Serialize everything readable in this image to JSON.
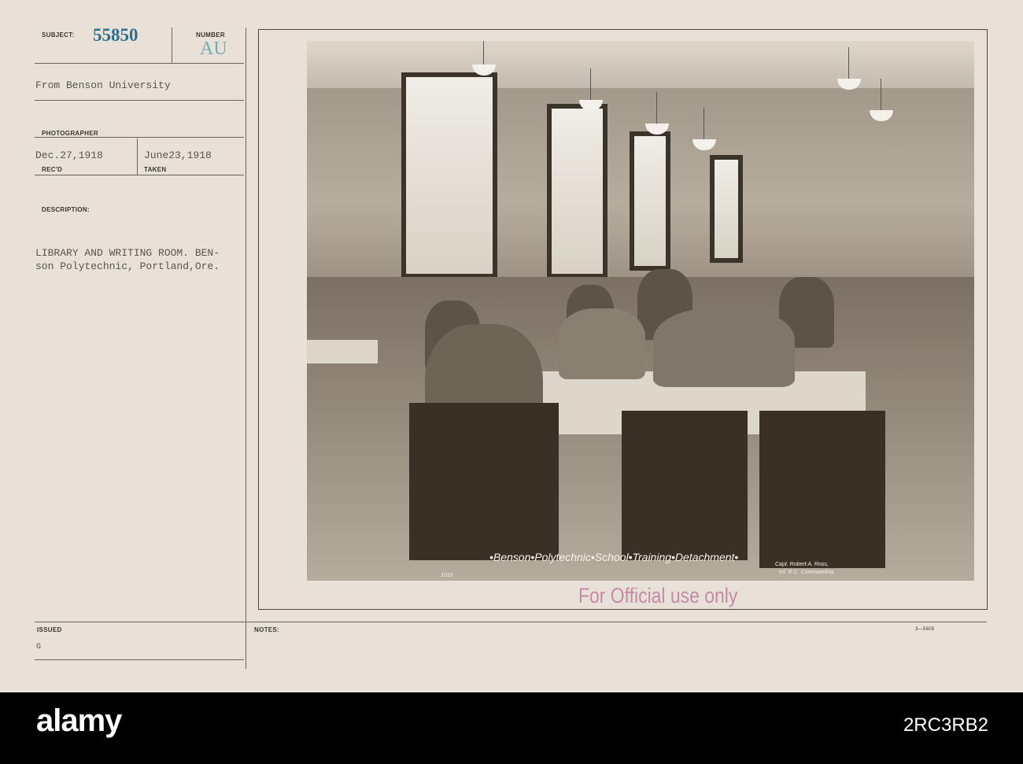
{
  "card": {
    "subject_label": "SUBJECT:",
    "subject_number": "55850",
    "number_label": "NUMBER",
    "number_value": "AU",
    "source": "From Benson University",
    "photographer_label": "PHOTOGRAPHER",
    "received_date": "Dec.27,1918",
    "received_label": "REC'D",
    "taken_date": "June23,1918",
    "taken_label": "TAKEN",
    "description_label": "DESCRIPTION:",
    "description_line1": "LIBRARY AND WRITING ROOM. BEN-",
    "description_line2": "son Polytechnic, Portland,Ore.",
    "issued_label": "ISSUED",
    "issued_value": "G",
    "notes_label": "NOTES:",
    "form_number": "3—5605"
  },
  "photo": {
    "caption": "•Benson•Polytechnic•School•Training•Detachment•",
    "credit_line1": "Capt. Robert A. Ross,",
    "credit_line2": "Inf. R.C. Commanding.",
    "negative_mark": "1010"
  },
  "stamp": "For Official use only",
  "watermark": {
    "brand": "alamy",
    "image_code": "2RC3RB2"
  }
}
